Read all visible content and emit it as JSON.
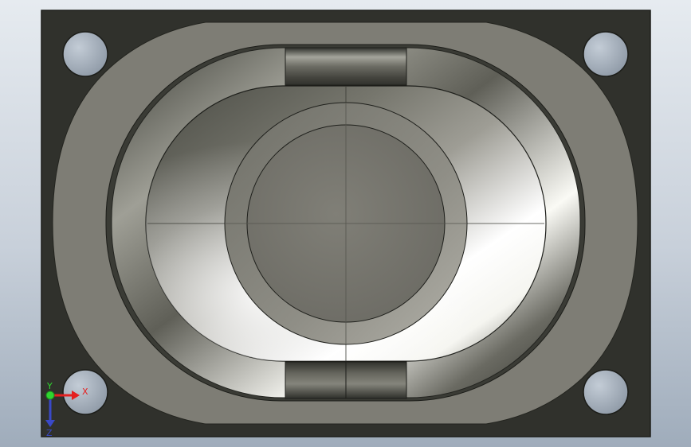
{
  "viewport": {
    "model": "speaker",
    "background_color": "#b4bfcc",
    "part_color_dark": "#2f302c",
    "part_color_flange": "#7e7d75",
    "cone_highlight": "#ffffff"
  },
  "triad": {
    "x_label": "X",
    "y_label": "Y",
    "z_label": "Z",
    "x_color": "#e42020",
    "y_color": "#2fd62f",
    "z_color": "#3a49c8"
  }
}
